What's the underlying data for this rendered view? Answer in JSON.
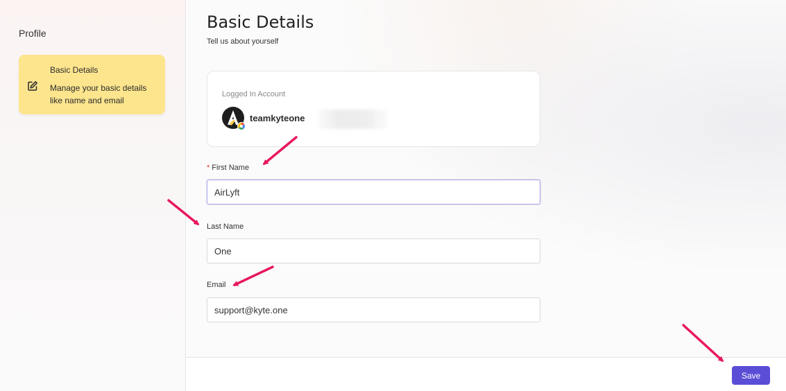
{
  "sidebar": {
    "title": "Profile",
    "items": [
      {
        "icon": "edit-icon",
        "title": "Basic Details",
        "description": "Manage your basic details like name and email",
        "active": true,
        "highlight_color": "#fde58e"
      }
    ]
  },
  "main": {
    "title": "Basic Details",
    "subtitle": "Tell us about yourself",
    "account": {
      "label": "Logged In Account",
      "username": "teamkyteone",
      "avatar_icon": "avatar-logo-icon"
    },
    "form": {
      "first_name": {
        "label": "First Name",
        "required_mark": "*",
        "value": "AirLyft"
      },
      "last_name": {
        "label": "Last Name",
        "value": "One"
      },
      "email": {
        "label": "Email",
        "value": "support@kyte.one"
      }
    }
  },
  "footer": {
    "save_label": "Save",
    "accent_color": "#5a4ed6"
  },
  "annotations": {
    "arrow_color": "#e8175d"
  }
}
